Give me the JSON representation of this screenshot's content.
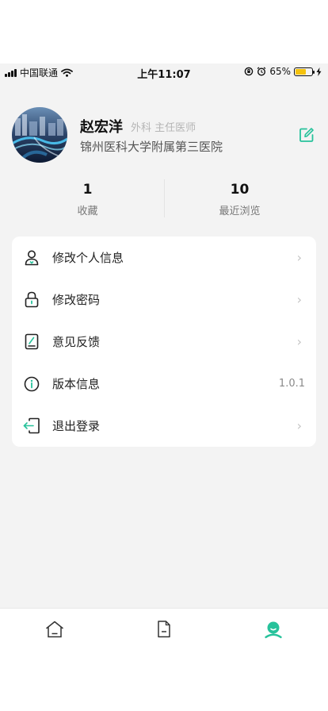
{
  "status_bar": {
    "carrier": "中国联通",
    "time": "上午11:07",
    "battery_percent": "65%",
    "battery_level": 0.65,
    "battery_color": "#f4c20d"
  },
  "profile": {
    "name": "赵宏洋",
    "department_title": "外科 主任医师",
    "hospital": "锦州医科大学附属第三医院",
    "avatar_icon": "night-city-photo",
    "edit_icon": "edit-icon"
  },
  "stats": [
    {
      "value": "1",
      "label": "收藏"
    },
    {
      "value": "10",
      "label": "最近浏览"
    }
  ],
  "menu": [
    {
      "label": "修改个人信息",
      "icon": "user-icon",
      "trailing": "›"
    },
    {
      "label": "修改密码",
      "icon": "lock-icon",
      "trailing": "›"
    },
    {
      "label": "意见反馈",
      "icon": "feedback-icon",
      "trailing": "›"
    },
    {
      "label": "版本信息",
      "icon": "info-icon",
      "trailing": "1.0.1"
    },
    {
      "label": "退出登录",
      "icon": "logout-icon",
      "trailing": "›"
    }
  ],
  "tabs": [
    {
      "icon": "home-icon",
      "active": false
    },
    {
      "icon": "document-icon",
      "active": false
    },
    {
      "icon": "profile-icon",
      "active": true
    }
  ],
  "colors": {
    "accent": "#27c29b",
    "background": "#f3f3f3",
    "card": "#ffffff"
  }
}
